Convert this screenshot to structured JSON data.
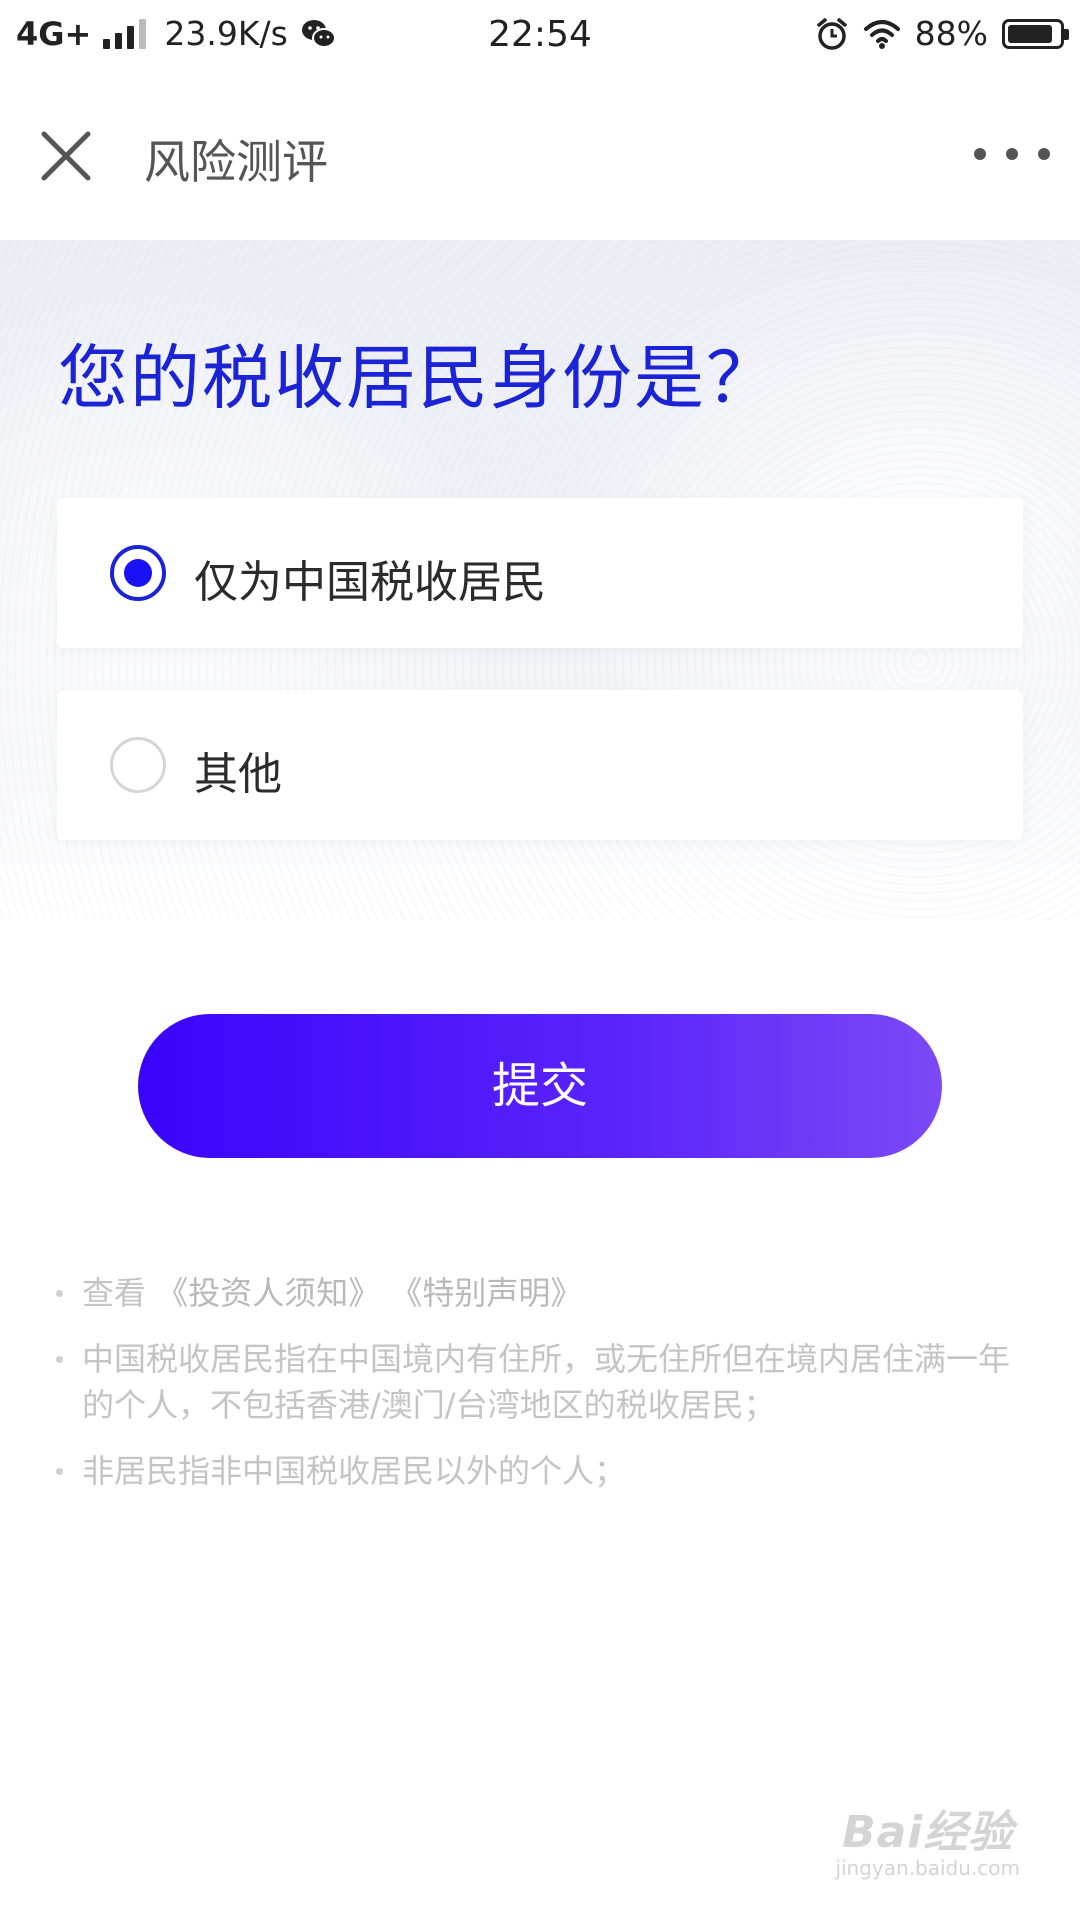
{
  "status_bar": {
    "network": "4G+",
    "speed": "23.9K/s",
    "time": "22:54",
    "battery": "88%",
    "icons": [
      "signal-icon",
      "wechat-icon",
      "alarm-icon",
      "wifi-icon",
      "battery-icon"
    ]
  },
  "nav": {
    "title": "风险测评",
    "icons": [
      "close-icon",
      "more-icon"
    ]
  },
  "question": {
    "title": "您的税收居民身份是？"
  },
  "options": [
    {
      "label": "仅为中国税收居民",
      "selected": true
    },
    {
      "label": "其他",
      "selected": false
    }
  ],
  "submit": {
    "label": "提交"
  },
  "notes": {
    "prefix": "查看",
    "link1": "《投资人须知》",
    "link2": "《特别声明》",
    "item2": "中国税收居民指在中国境内有住所，或无住所但在境内居住满一年的个人，不包括香港/澳门/台湾地区的税收居民；",
    "item3": "非居民指非中国税收居民以外的个人；"
  },
  "watermark": {
    "logo": "Bai经验",
    "url": "jingyan.baidu.com"
  },
  "colors": {
    "accent": "#1a23d6",
    "button_start": "#3a04fb",
    "button_end": "#7c49f5",
    "note_text": "#c4c4c4"
  }
}
